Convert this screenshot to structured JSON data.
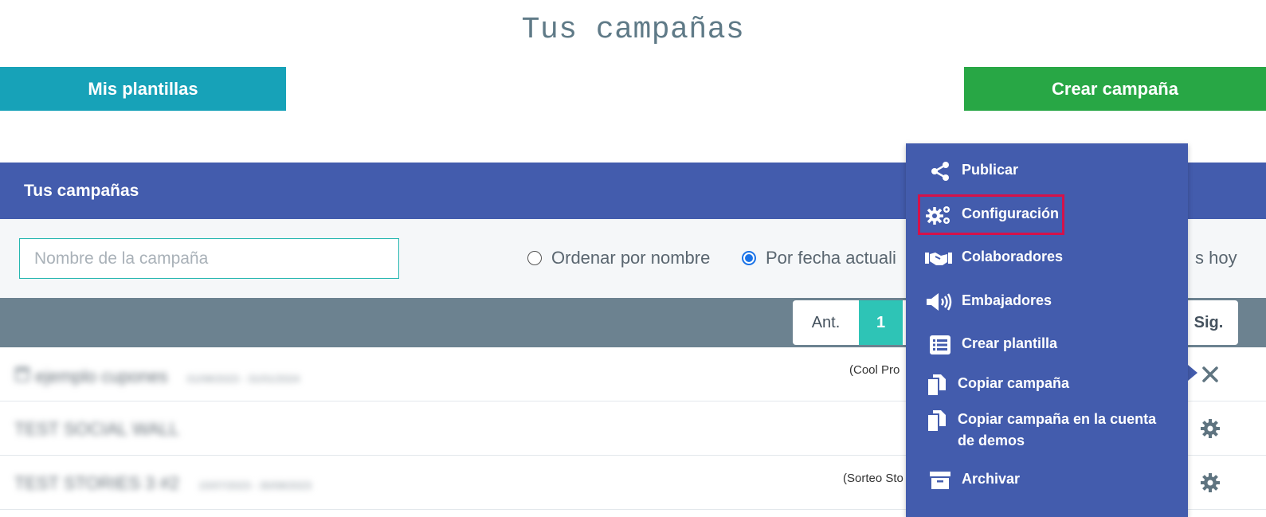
{
  "page": {
    "title": "Tus campañas",
    "templates_button": "Mis plantillas",
    "create_button": "Crear campaña"
  },
  "panel": {
    "header": "Tus campañas",
    "search_placeholder": "Nombre de la campaña",
    "sort_by_name": "Ordenar por nombre",
    "sort_by_date": "Por fecha actuali",
    "sort_hoy": "s hoy",
    "selected_sort": "date"
  },
  "pagination": {
    "prev": "Ant.",
    "current_page": "1",
    "next": "Sig."
  },
  "campaigns": [
    {
      "name": "ejemplo cupones",
      "dates": "01/08/2023 - 31/01/2024",
      "type": "(Cool Pro",
      "action_icon": "close-icon"
    },
    {
      "name": "TEST SOCIAL WALL",
      "dates": "",
      "type": "",
      "action_icon": "gear-icon"
    },
    {
      "name": "TEST STORIES 3 #2",
      "dates": "15/07/2023 - 30/08/2023",
      "type": "(Sorteo Sto",
      "action_icon": "gear-icon"
    }
  ],
  "dropdown_menu": {
    "items": [
      {
        "label": "Publicar",
        "icon": "share-icon"
      },
      {
        "label": "Configuración",
        "icon": "gears-icon"
      },
      {
        "label": "Colaboradores",
        "icon": "handshake-icon"
      },
      {
        "label": "Embajadores",
        "icon": "megaphone-icon"
      },
      {
        "label": "Crear plantilla",
        "icon": "list-icon"
      },
      {
        "label": "Copiar campaña",
        "icon": "copy-icon"
      },
      {
        "label": "Copiar campaña en la cuenta",
        "label_line2": "de demos",
        "icon": "copy-icon"
      },
      {
        "label": "Archivar",
        "icon": "archive-icon"
      }
    ],
    "highlighted": "Configuración"
  },
  "colors": {
    "header_blue": "#435cad",
    "templates_teal": "#17a2b8",
    "create_green": "#28a745",
    "highlight_red": "#d4124a",
    "page_active": "#2ec4b6"
  }
}
